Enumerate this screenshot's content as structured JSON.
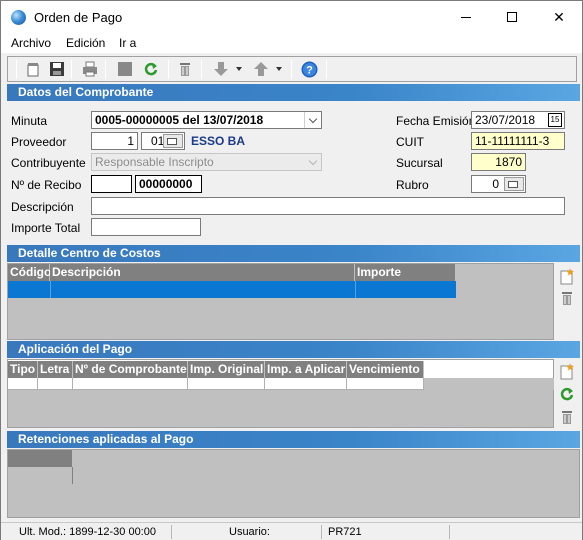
{
  "window": {
    "title": "Orden de Pago",
    "app_icon": "globe-icon",
    "controls": {
      "min": "minimize-icon",
      "max": "maximize-icon",
      "close": "✕"
    }
  },
  "menu": [
    "Archivo",
    "Edición",
    "Ir a"
  ],
  "toolbar": {
    "buttons": [
      "new-doc-icon",
      "save-icon",
      "print-icon",
      "stop-icon",
      "refresh-icon",
      "trash-icon",
      "arrow-down-icon",
      "arrow-up-icon",
      "help-icon"
    ]
  },
  "sections": {
    "comprobante": "Datos del Comprobante",
    "costos": "Detalle Centro de Costos",
    "aplicacion": "Aplicación del Pago",
    "retenciones": "Retenciones aplicadas al Pago"
  },
  "form": {
    "minuta_label": "Minuta",
    "minuta_value": "0005-00000005 del 13/07/2018",
    "proveedor_label": "Proveedor",
    "proveedor_code": "1",
    "proveedor_sub": "01",
    "proveedor_name": "ESSO BA",
    "contribuyente_label": "Contribuyente",
    "contribuyente_value": "Responsable Inscripto",
    "recibo_label": "Nº de Recibo",
    "recibo_prefix": "",
    "recibo_number": "00000000",
    "descripcion_label": "Descripción",
    "descripcion_value": "",
    "importe_label": "Importe Total",
    "importe_value": "",
    "fecha_label": "Fecha Emisión",
    "fecha_value": "23/07/2018",
    "fecha_icon_text": "15",
    "cuit_label": "CUIT",
    "cuit_value": "11-11111111-3",
    "sucursal_label": "Sucursal",
    "sucursal_value": "1870",
    "rubro_label": "Rubro",
    "rubro_value": "0"
  },
  "costos_grid": {
    "columns": [
      "Código",
      "Descripción",
      "Importe"
    ]
  },
  "aplicacion_grid": {
    "columns": [
      "Tipo",
      "Letra",
      "Nº de Comprobante",
      "Imp. Original",
      "Imp. a Aplicar",
      "Vencimiento"
    ]
  },
  "status": {
    "ult_mod": "Ult. Mod.: 1899-12-30 00:00",
    "usuario": "Usuario:",
    "code": "PR721"
  },
  "colors": {
    "section_header": "#3a78bd",
    "grid_header": "#808080",
    "selected_row": "#0a78d2",
    "highlight_field": "#ffffcc"
  }
}
